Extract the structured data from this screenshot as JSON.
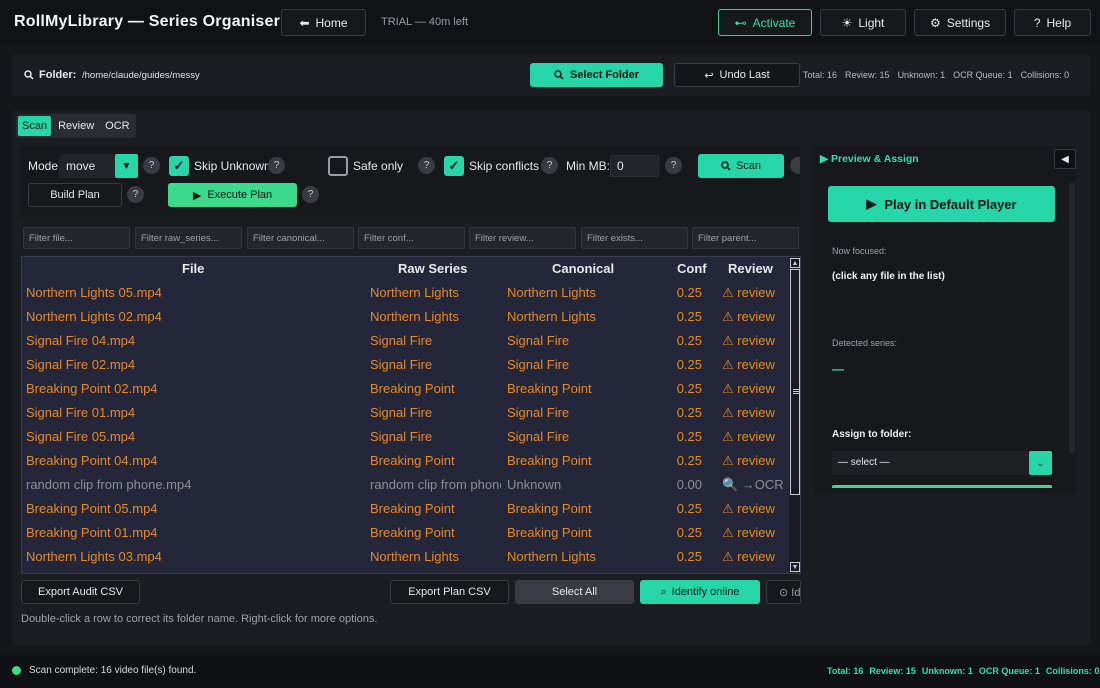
{
  "app": {
    "title": "RollMyLibrary — Series Organiser",
    "trial": "TRIAL — 40m left"
  },
  "topbar": {
    "home": "Home",
    "home_icon": "⬅",
    "activate": "Activate",
    "activate_icon": "⊷",
    "light": "Light",
    "light_icon": "☀",
    "settings": "Settings",
    "settings_icon": "⚙",
    "help": "Help",
    "help_icon": "?"
  },
  "folder": {
    "label": "Folder:",
    "path": "/home/claude/guides/messy",
    "select_button": "Select Folder",
    "undo_button": "Undo Last",
    "stats": [
      "Total: 16",
      "Review: 15",
      "Unknown: 1",
      "OCR Queue: 1",
      "Collisions: 0"
    ]
  },
  "tabs": [
    "Scan",
    "Review",
    "OCR"
  ],
  "controls": {
    "mode_label": "Mode:",
    "mode_value": "move",
    "skip_unknown": "Skip Unknown",
    "safe_only": "Safe only",
    "skip_conflicts": "Skip conflicts",
    "min_mb_label": "Min MB:",
    "min_mb_value": "0",
    "scan_button": "Scan",
    "build_plan": "Build Plan",
    "execute_plan": "Execute Plan",
    "help_mark": "?"
  },
  "filters": [
    "Filter file...",
    "Filter raw_series...",
    "Filter canonical...",
    "Filter conf...",
    "Filter review...",
    "Filter exists...",
    "Filter parent..."
  ],
  "table": {
    "headers": {
      "file": "File",
      "raw": "Raw Series",
      "canonical": "Canonical",
      "conf": "Conf",
      "review": "Review"
    },
    "rows": [
      {
        "file": "Northern Lights 05.mp4",
        "raw": "Northern Lights",
        "canonical": "Northern Lights",
        "conf": "0.25",
        "review": "⚠ review"
      },
      {
        "file": "Northern Lights 02.mp4",
        "raw": "Northern Lights",
        "canonical": "Northern Lights",
        "conf": "0.25",
        "review": "⚠ review"
      },
      {
        "file": "Signal Fire 04.mp4",
        "raw": "Signal Fire",
        "canonical": "Signal Fire",
        "conf": "0.25",
        "review": "⚠ review"
      },
      {
        "file": "Signal Fire 02.mp4",
        "raw": "Signal Fire",
        "canonical": "Signal Fire",
        "conf": "0.25",
        "review": "⚠ review"
      },
      {
        "file": "Breaking Point 02.mp4",
        "raw": "Breaking Point",
        "canonical": "Breaking Point",
        "conf": "0.25",
        "review": "⚠ review"
      },
      {
        "file": "Signal Fire 01.mp4",
        "raw": "Signal Fire",
        "canonical": "Signal Fire",
        "conf": "0.25",
        "review": "⚠ review"
      },
      {
        "file": "Signal Fire 05.mp4",
        "raw": "Signal Fire",
        "canonical": "Signal Fire",
        "conf": "0.25",
        "review": "⚠ review"
      },
      {
        "file": "Breaking Point 04.mp4",
        "raw": "Breaking Point",
        "canonical": "Breaking Point",
        "conf": "0.25",
        "review": "⚠ review"
      },
      {
        "file": "random clip from phone.mp4",
        "raw": "random clip from phone",
        "canonical": "Unknown",
        "conf": "0.00",
        "review": "🔍 →OCR",
        "muted": true
      },
      {
        "file": "Breaking Point 05.mp4",
        "raw": "Breaking Point",
        "canonical": "Breaking Point",
        "conf": "0.25",
        "review": "⚠ review"
      },
      {
        "file": "Breaking Point 01.mp4",
        "raw": "Breaking Point",
        "canonical": "Breaking Point",
        "conf": "0.25",
        "review": "⚠ review"
      },
      {
        "file": "Northern Lights 03.mp4",
        "raw": "Northern Lights",
        "canonical": "Northern Lights",
        "conf": "0.25",
        "review": "⚠ review"
      }
    ]
  },
  "bottom": {
    "export_audit": "Export Audit CSV",
    "export_plan": "Export Plan CSV",
    "select_all": "Select All",
    "identify_online": "Identify online",
    "identify_icon": "⌕",
    "partial_button": "⊙ Id",
    "hint": "Double-click a row to correct its folder name. Right-click for more options."
  },
  "preview": {
    "title": "▶ Preview & Assign",
    "collapse": "◀",
    "play_button": "Play in Default Player",
    "play_icon": "▶",
    "now_focused_label": "Now focused:",
    "now_focused_value": "(click any file in the list)",
    "detected_label": "Detected series:",
    "detected_value": "—",
    "assign_label": "Assign to folder:",
    "assign_value": "— select —"
  },
  "status": {
    "text": "Scan complete: 16 video file(s) found.",
    "stats": [
      "Total: 16",
      "Review: 15",
      "Unknown: 1",
      "OCR Queue: 1",
      "Collisions: 0"
    ]
  },
  "colors": {
    "accent": "#27d6a8",
    "green": "#3bd98c",
    "row_text": "#e58a2a",
    "muted_text": "#8c8e95"
  }
}
